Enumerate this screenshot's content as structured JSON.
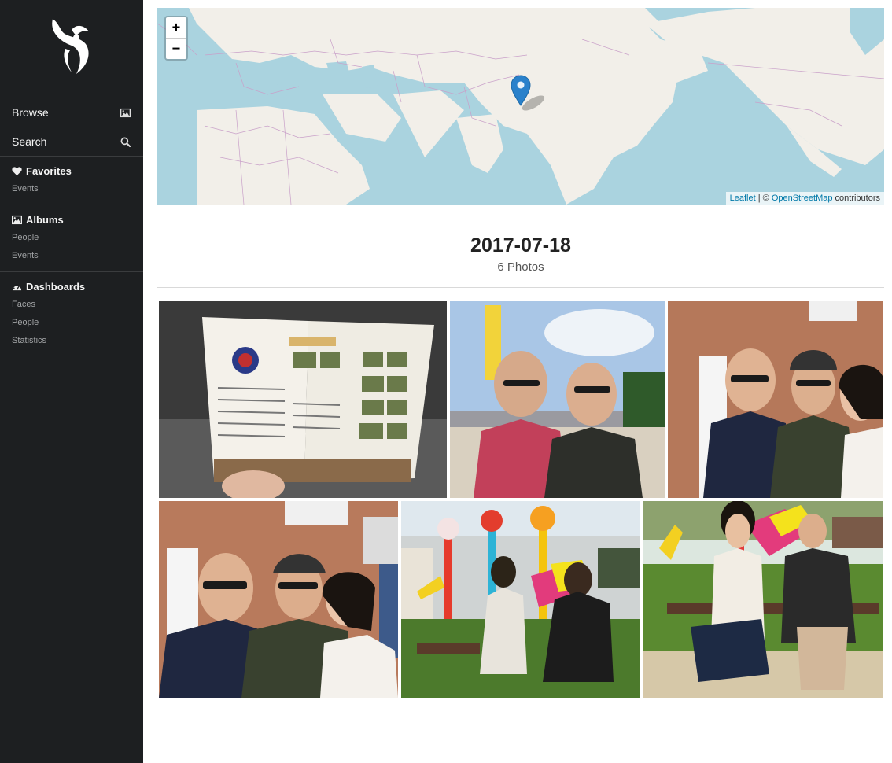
{
  "sidebar": {
    "browse": "Browse",
    "search": "Search",
    "favorites": {
      "title": "Favorites",
      "items": [
        "Events"
      ]
    },
    "albums": {
      "title": "Albums",
      "items": [
        "People",
        "Events"
      ]
    },
    "dashboards": {
      "title": "Dashboards",
      "items": [
        "Faces",
        "People",
        "Statistics"
      ]
    }
  },
  "map": {
    "zoom_in": "+",
    "zoom_out": "−",
    "attribution": {
      "leaflet": "Leaflet",
      "sep": " | © ",
      "osm": "OpenStreetMap",
      "suffix": " contributors"
    }
  },
  "event": {
    "date": "2017-07-18",
    "count": "6 Photos"
  },
  "icons": {
    "browse": "image-icon",
    "search": "search-icon",
    "favorites": "heart-icon",
    "albums": "image-icon",
    "dashboards": "dashboard-icon",
    "marker": "map-marker-icon"
  },
  "colors": {
    "sidebar_bg": "#1d1f21",
    "map_water": "#aad3df",
    "map_land": "#f2efe9",
    "marker": "#2a81cb",
    "link": "#0078a8"
  }
}
